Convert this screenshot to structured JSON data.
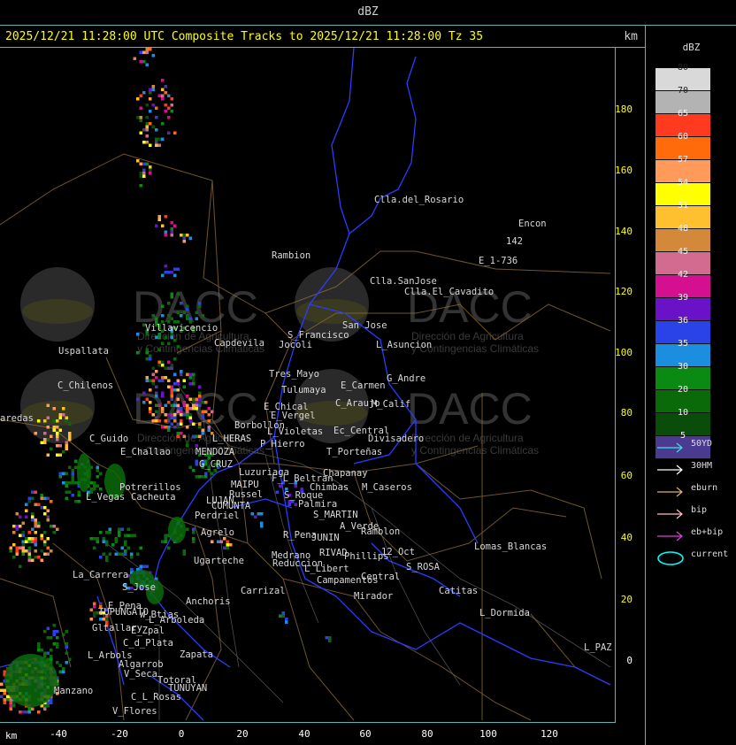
{
  "top_title": "dBZ",
  "header": {
    "title": "2025/12/21 11:28:00 UTC Composite Tracks to 2025/12/21 11:28:00 Tz 35",
    "km_label": "km"
  },
  "y_axis": {
    "ticks": [
      "180",
      "160",
      "140",
      "120",
      "100",
      "80",
      "60",
      "40",
      "20",
      "0"
    ]
  },
  "x_axis": {
    "km_label": "km",
    "ticks": [
      "-40",
      "-20",
      "0",
      "20",
      "40",
      "60",
      "80",
      "100",
      "120"
    ]
  },
  "legend": {
    "title": "dBZ",
    "scale": [
      {
        "label": "80",
        "color": "#d9d9d9"
      },
      {
        "label": "70",
        "color": "#b3b3b3"
      },
      {
        "label": "65",
        "color": "#ff3a1f"
      },
      {
        "label": "60",
        "color": "#ff6a0a"
      },
      {
        "label": "57",
        "color": "#ff9a5a"
      },
      {
        "label": "54",
        "color": "#ffff00"
      },
      {
        "label": "51",
        "color": "#ffc030"
      },
      {
        "label": "48",
        "color": "#d4883a"
      },
      {
        "label": "45",
        "color": "#d36b90"
      },
      {
        "label": "42",
        "color": "#d40f90"
      },
      {
        "label": "39",
        "color": "#6a12c8"
      },
      {
        "label": "36",
        "color": "#2a43e8"
      },
      {
        "label": "35",
        "color": "#1b8ee0"
      },
      {
        "label": "30",
        "color": "#0a8a12"
      },
      {
        "label": "20",
        "color": "#0a6a0a"
      },
      {
        "label": "10",
        "color": "#0a4d0a"
      },
      {
        "label": "5",
        "color": "#4a3a90"
      }
    ],
    "items": [
      {
        "label": "50YD",
        "color": "#40e0e0"
      },
      {
        "label": "30HM",
        "color": "#ffffff"
      },
      {
        "label": "eburn",
        "color": "#e0b070"
      },
      {
        "label": "bip",
        "color": "#ffc0c0"
      },
      {
        "label": "eb+bip",
        "color": "#e040e0"
      },
      {
        "label": "current",
        "color": "#00ffff"
      }
    ]
  },
  "watermark": {
    "brand": "DACC",
    "line1": "Dirección de Agricultura",
    "line2": "y Contingencias Climáticas"
  },
  "cities": [
    {
      "name": "Clla.del_Rosario"
    },
    {
      "name": "Encon"
    },
    {
      "name": "Rambion"
    },
    {
      "name": "142"
    },
    {
      "name": "E_1-736"
    },
    {
      "name": "Clla.SanJose"
    },
    {
      "name": "Clla.El_Cavadito"
    },
    {
      "name": "Villavicencio"
    },
    {
      "name": "San Jose"
    },
    {
      "name": "Capdevila"
    },
    {
      "name": "S_Francisco"
    },
    {
      "name": "L_Asuncion"
    },
    {
      "name": "Uspallata"
    },
    {
      "name": "Jocoli"
    },
    {
      "name": "Tres_Mayo"
    },
    {
      "name": "G_Andre"
    },
    {
      "name": "C_Chilenos"
    },
    {
      "name": "Tulumaya"
    },
    {
      "name": "E_Carmen"
    },
    {
      "name": "E_Chical"
    },
    {
      "name": "C_Araujo"
    },
    {
      "name": "M_Calif"
    },
    {
      "name": "E_Vergel"
    },
    {
      "name": "aredas"
    },
    {
      "name": "Borbollon"
    },
    {
      "name": "L_Violetas"
    },
    {
      "name": "Ec_Central"
    },
    {
      "name": "Divisadero"
    },
    {
      "name": "C_Guido"
    },
    {
      "name": "L_HERAS"
    },
    {
      "name": "P_Hierro"
    },
    {
      "name": "E_Challao"
    },
    {
      "name": "MENDOZA"
    },
    {
      "name": "T_Porteñas"
    },
    {
      "name": "G_CRUZ"
    },
    {
      "name": "Luzuriaga"
    },
    {
      "name": "Chapanay"
    },
    {
      "name": "F_L_Beltran"
    },
    {
      "name": "MAIPU"
    },
    {
      "name": "Chimbas"
    },
    {
      "name": "M_Caseros"
    },
    {
      "name": "Potrerillos"
    },
    {
      "name": "Russel"
    },
    {
      "name": "L_Vegas"
    },
    {
      "name": "Cacheuta"
    },
    {
      "name": "S_Roque"
    },
    {
      "name": "LUJAN"
    },
    {
      "name": "Palmira"
    },
    {
      "name": "CUMUNTA"
    },
    {
      "name": "S_MARTIN"
    },
    {
      "name": "Perdriel"
    },
    {
      "name": "A_Verde"
    },
    {
      "name": "Ramblon"
    },
    {
      "name": "Agrelo"
    },
    {
      "name": "R_Pena"
    },
    {
      "name": "JUNIN"
    },
    {
      "name": "Lomas_Blancas"
    },
    {
      "name": "Ugarteche"
    },
    {
      "name": "Medrano"
    },
    {
      "name": "RIVAD"
    },
    {
      "name": "Phillips"
    },
    {
      "name": "12_Oct"
    },
    {
      "name": "Reduccion"
    },
    {
      "name": "S_ROSA"
    },
    {
      "name": "L_Libert"
    },
    {
      "name": "Central"
    },
    {
      "name": "La_Carrera"
    },
    {
      "name": "Campamentos"
    },
    {
      "name": "S_Jose"
    },
    {
      "name": "Catitas"
    },
    {
      "name": "Carrizal"
    },
    {
      "name": "Anchoris"
    },
    {
      "name": "E_Pena"
    },
    {
      "name": "Mirador"
    },
    {
      "name": "TUPUNGATO"
    },
    {
      "name": "L_Dormida"
    },
    {
      "name": "L_Arboleda"
    },
    {
      "name": "Gltallary"
    },
    {
      "name": "E_Zpal"
    },
    {
      "name": "C_d_Plata"
    },
    {
      "name": "L_Arbols"
    },
    {
      "name": "Zapata"
    },
    {
      "name": "L_PAZ"
    },
    {
      "name": "Algarrob"
    },
    {
      "name": "V_Seca"
    },
    {
      "name": "Totoral"
    },
    {
      "name": "Manzano"
    },
    {
      "name": "TUNUYAN"
    },
    {
      "name": "C_L_Rosas"
    },
    {
      "name": "V_Flores"
    },
    {
      "name": "W_Btias"
    }
  ]
}
